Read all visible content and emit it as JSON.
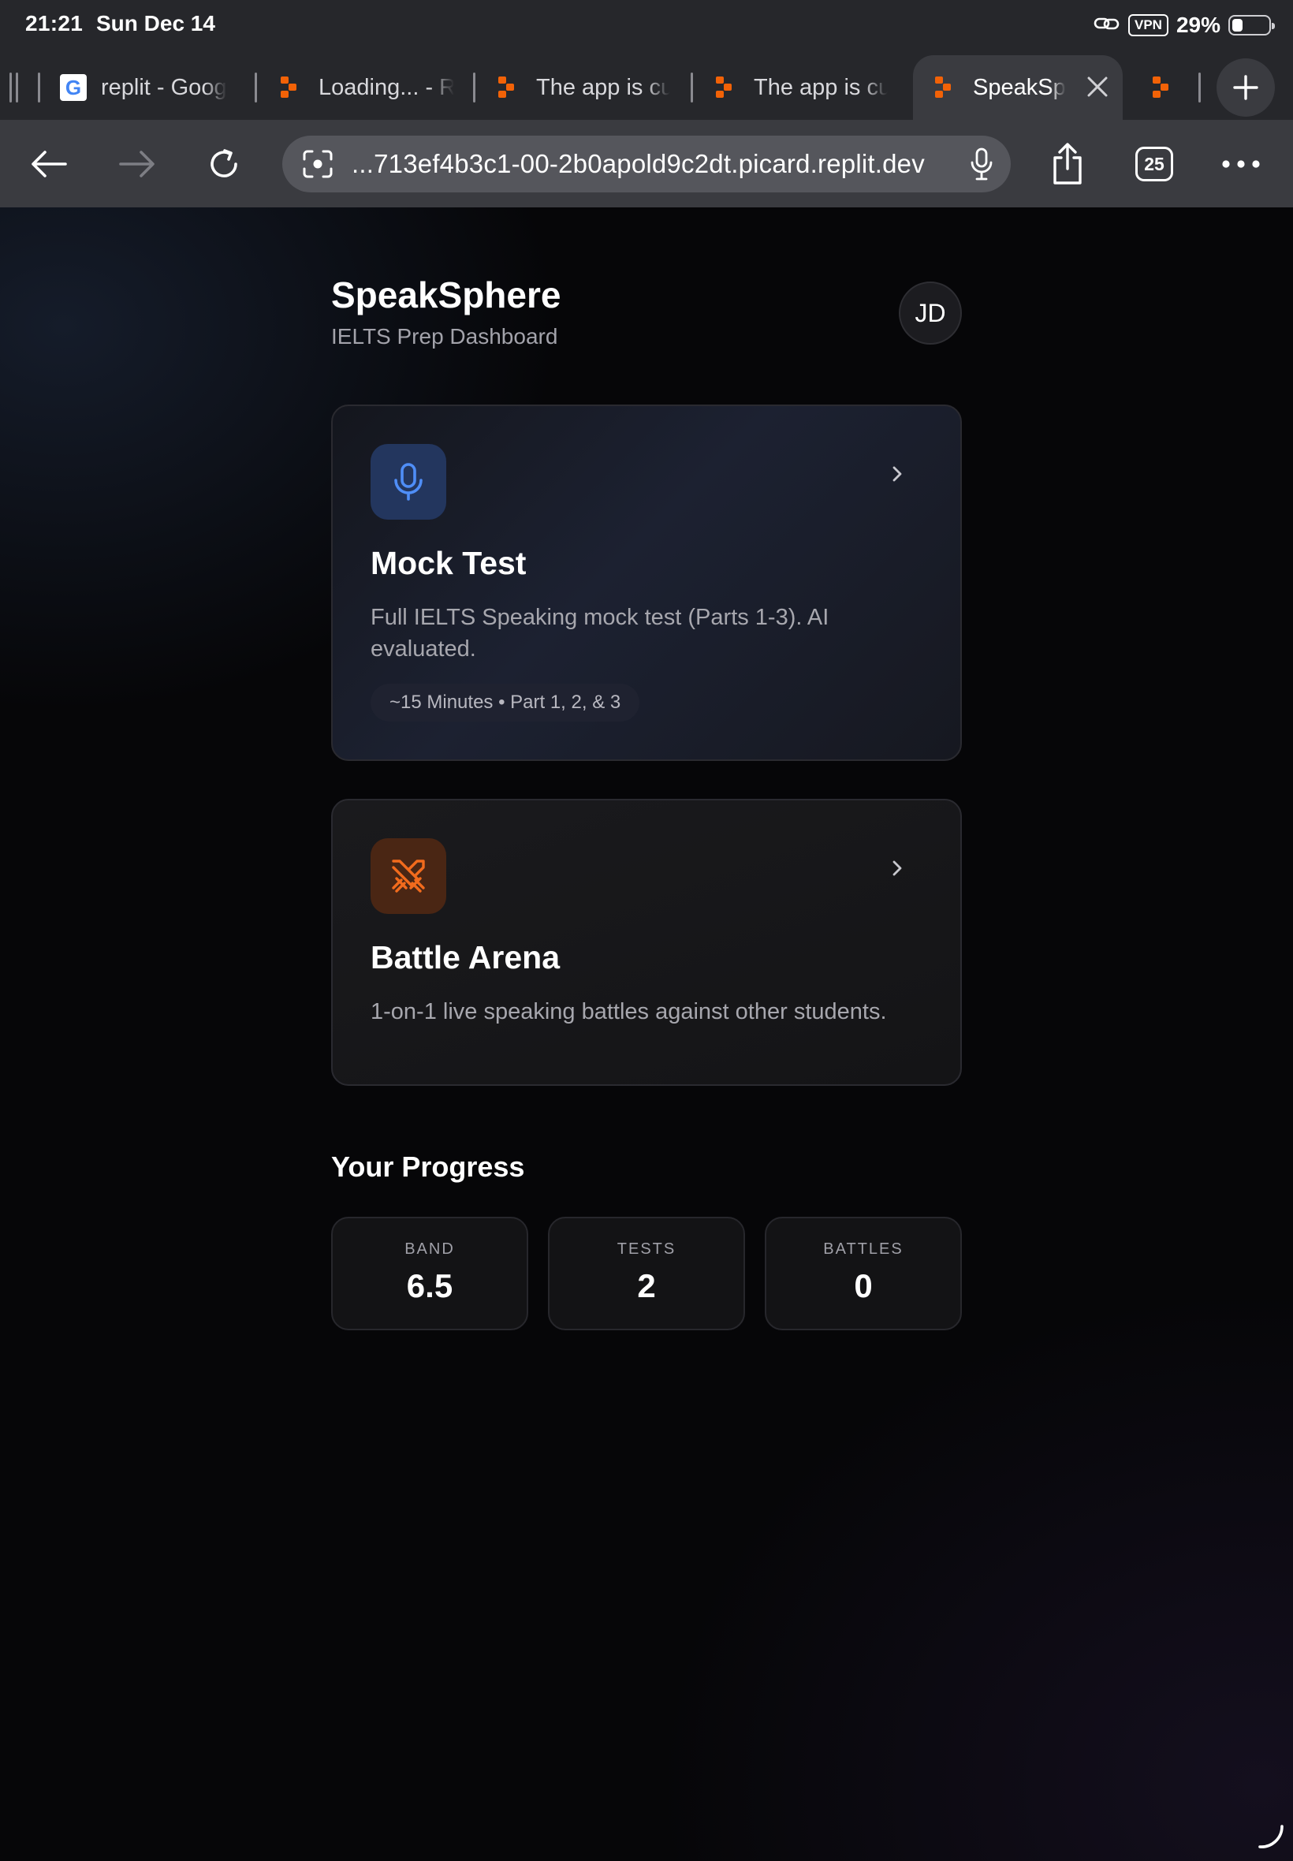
{
  "status_bar": {
    "time": "21:21",
    "date": "Sun Dec 14",
    "vpn": "VPN",
    "battery": "29%",
    "battery_level": 0.29
  },
  "tabs": [
    {
      "label": "replit - Goog",
      "favicon": "google-icon"
    },
    {
      "label": "Loading... - R",
      "favicon": "replit-icon"
    },
    {
      "label": "The app is cu",
      "favicon": "replit-icon"
    },
    {
      "label": "The app is cu",
      "favicon": "replit-icon"
    },
    {
      "label": "SpeakSp",
      "favicon": "replit-icon",
      "active": true
    }
  ],
  "toolbar": {
    "url": "...713ef4b3c1-00-2b0apold9c2dt.picard.replit.dev",
    "tab_count": "25"
  },
  "header": {
    "title": "SpeakSphere",
    "subtitle": "IELTS Prep Dashboard",
    "avatar_initials": "JD"
  },
  "cards": [
    {
      "title": "Mock Test",
      "description": "Full IELTS Speaking mock test (Parts 1-3). AI evaluated.",
      "meta": "~15 Minutes • Part 1, 2, & 3",
      "icon": "microphone-icon",
      "accent": "#4f8ef7"
    },
    {
      "title": "Battle Arena",
      "description": "1-on-1 live speaking battles against other students.",
      "icon": "crossed-swords-icon",
      "accent": "#f26b1d"
    }
  ],
  "progress": {
    "title": "Your Progress",
    "stats": [
      {
        "label": "BAND",
        "value": "6.5"
      },
      {
        "label": "TESTS",
        "value": "2"
      },
      {
        "label": "BATTLES",
        "value": "0"
      }
    ]
  }
}
